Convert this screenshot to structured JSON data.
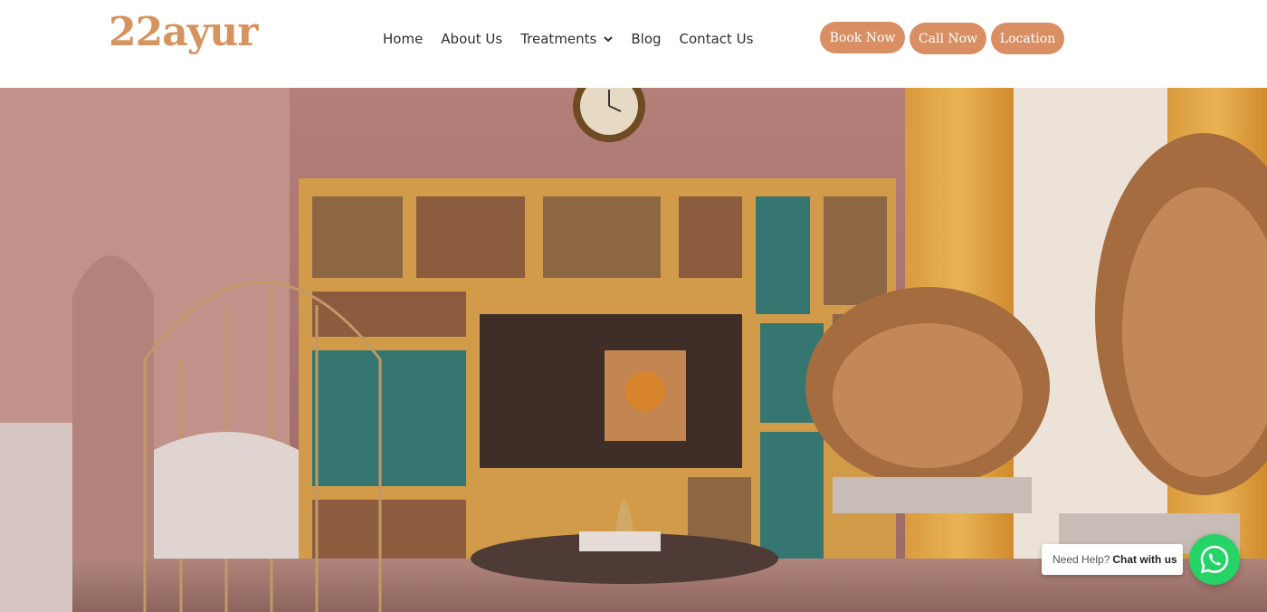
{
  "header": {
    "logo_text": "22ayur",
    "nav": [
      {
        "label": "Home"
      },
      {
        "label": "About Us"
      },
      {
        "label": "Treatments",
        "has_dropdown": true
      },
      {
        "label": "Blog"
      },
      {
        "label": "Contact Us"
      }
    ],
    "buttons": {
      "book": "Book Now",
      "call": "Call Now",
      "location": "Location"
    }
  },
  "hero": {
    "image": "clinic-lounge-photo",
    "icon_names": [
      "clock",
      "shelves",
      "tv",
      "peacock-chair",
      "cage-chair",
      "coffee-table"
    ]
  },
  "chat": {
    "prefix": "Need Help?",
    "cta": "Chat with us",
    "icon": "whatsapp-icon"
  },
  "colors": {
    "brand": "#d6935f",
    "button": "#d98f63",
    "whatsapp": "#25d366",
    "nav_text": "#2f2f2f"
  }
}
